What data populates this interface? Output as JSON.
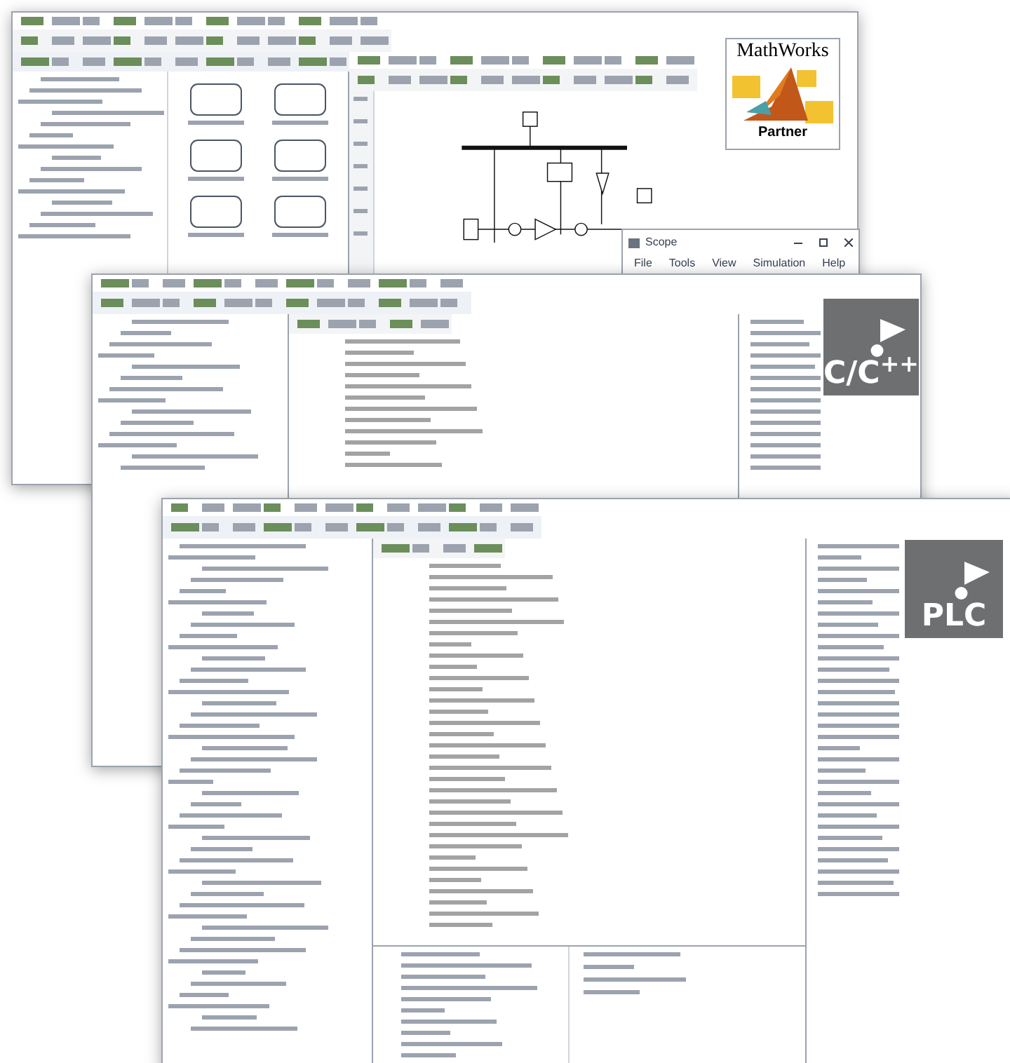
{
  "mathworks_logo": {
    "name": "MathWorks",
    "caption": "Partner"
  },
  "scope_window": {
    "title": "Scope",
    "menu": [
      "File",
      "Tools",
      "View",
      "Simulation",
      "Help"
    ]
  },
  "cpp_badge": {
    "label": "C/C$^{++}$"
  },
  "plc_badge": {
    "label": "PLC"
  }
}
